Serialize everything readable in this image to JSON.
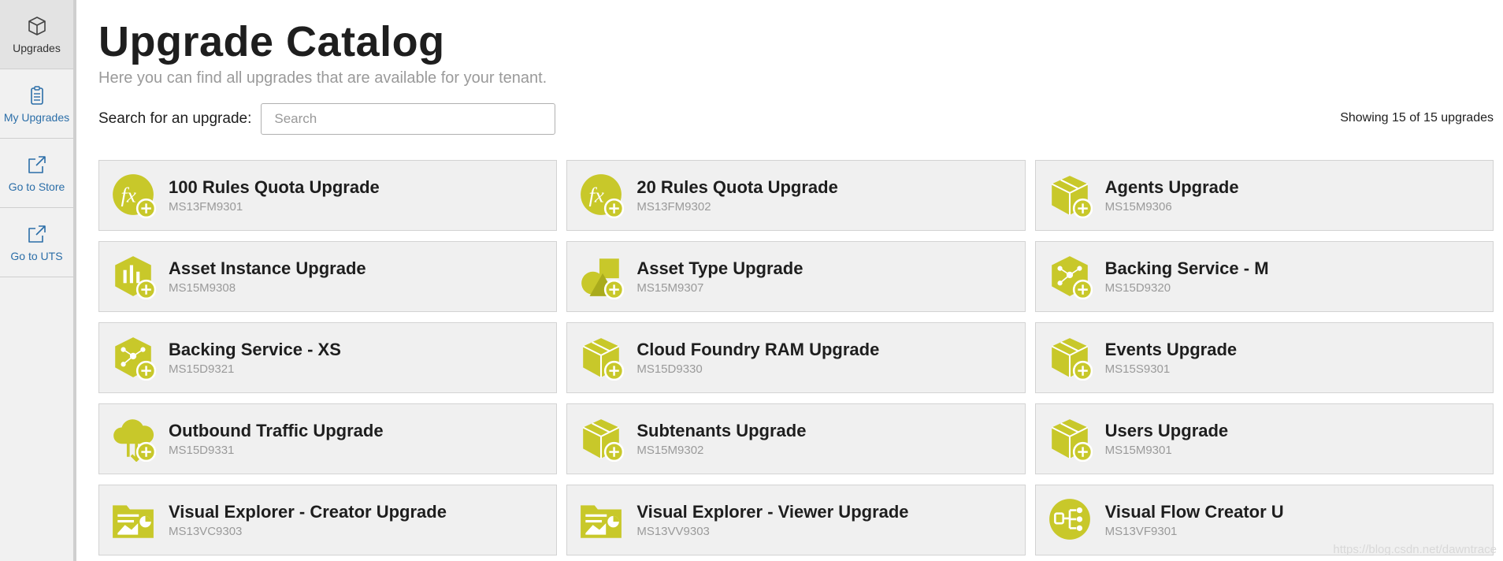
{
  "sidebar": {
    "items": [
      {
        "label": "Upgrades",
        "icon": "box-icon"
      },
      {
        "label": "My Upgrades",
        "icon": "clipboard-icon"
      },
      {
        "label": "Go to Store",
        "icon": "external-link-icon"
      },
      {
        "label": "Go to UTS",
        "icon": "external-link-icon"
      }
    ]
  },
  "header": {
    "title": "Upgrade Catalog",
    "subtitle": "Here you can find all upgrades that are available for your tenant."
  },
  "search": {
    "label": "Search for an upgrade:",
    "placeholder": "Search",
    "value": ""
  },
  "results": {
    "count_text": "Showing 15 of 15 upgrades"
  },
  "colors": {
    "accent": "#c8c82a",
    "accent_dark": "#a9ab1c",
    "link": "#2b6ea8"
  },
  "cards": [
    {
      "title": "100 Rules Quota Upgrade",
      "code": "MS13FM9301",
      "icon": "function-icon"
    },
    {
      "title": "20 Rules Quota Upgrade",
      "code": "MS13FM9302",
      "icon": "function-icon"
    },
    {
      "title": "Agents Upgrade",
      "code": "MS15M9306",
      "icon": "box-add-icon"
    },
    {
      "title": "Asset Instance Upgrade",
      "code": "MS15M9308",
      "icon": "asset-instance-icon"
    },
    {
      "title": "Asset Type Upgrade",
      "code": "MS15M9307",
      "icon": "asset-type-icon"
    },
    {
      "title": "Backing Service - M",
      "code": "MS15D9320",
      "icon": "network-hex-icon"
    },
    {
      "title": "Backing Service - XS",
      "code": "MS15D9321",
      "icon": "network-hex-icon"
    },
    {
      "title": "Cloud Foundry RAM Upgrade",
      "code": "MS15D9330",
      "icon": "box-add-icon"
    },
    {
      "title": "Events Upgrade",
      "code": "MS15S9301",
      "icon": "box-add-icon"
    },
    {
      "title": "Outbound Traffic Upgrade",
      "code": "MS15D9331",
      "icon": "cloud-traffic-icon"
    },
    {
      "title": "Subtenants Upgrade",
      "code": "MS15M9302",
      "icon": "box-add-icon"
    },
    {
      "title": "Users Upgrade",
      "code": "MS15M9301",
      "icon": "box-add-icon"
    },
    {
      "title": "Visual Explorer - Creator Upgrade",
      "code": "MS13VC9303",
      "icon": "folder-chart-icon"
    },
    {
      "title": "Visual Explorer - Viewer Upgrade",
      "code": "MS13VV9303",
      "icon": "folder-chart-icon"
    },
    {
      "title": "Visual Flow Creator U",
      "code": "MS13VF9301",
      "icon": "flow-icon"
    }
  ],
  "watermark": "https://blog.csdn.net/dawntrace"
}
